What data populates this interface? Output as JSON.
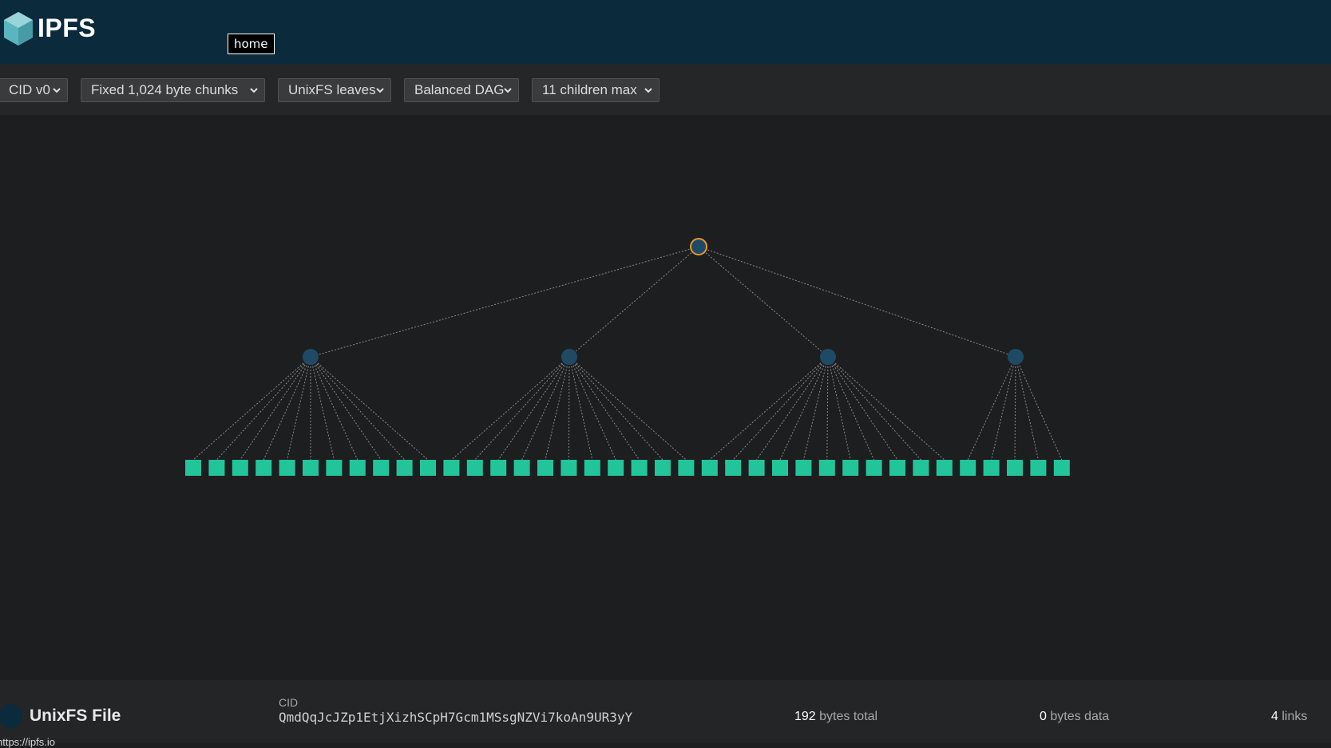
{
  "header": {
    "brand": "IPFS",
    "tooltip": "home"
  },
  "toolbar": {
    "selects": [
      {
        "value": "CID v0"
      },
      {
        "value": "Fixed 1,024 byte chunks"
      },
      {
        "value": "UnixFS leaves"
      },
      {
        "value": "Balanced DAG"
      },
      {
        "value": "11 children max"
      }
    ]
  },
  "dag": {
    "root": {
      "selected": true
    },
    "intermediate_nodes": 4,
    "leaves_per_node": [
      11,
      11,
      11,
      5
    ],
    "colors": {
      "node": "#1e4a66",
      "selected_ring": "#e8962c",
      "leaf": "#22c59a",
      "edge": "#8a8a8a"
    }
  },
  "footer": {
    "type_title": "UnixFS File",
    "cid_label": "CID",
    "cid": "QmdQqJcJZp1EtjXizhSCpH7Gcm1MSsgNZVi7koAn9UR3yY",
    "bytes_total_num": "192",
    "bytes_total_label": "bytes total",
    "bytes_data_num": "0",
    "bytes_data_label": "bytes data",
    "links_num": "4",
    "links_label": "links",
    "status_url": "https://ipfs.io"
  }
}
